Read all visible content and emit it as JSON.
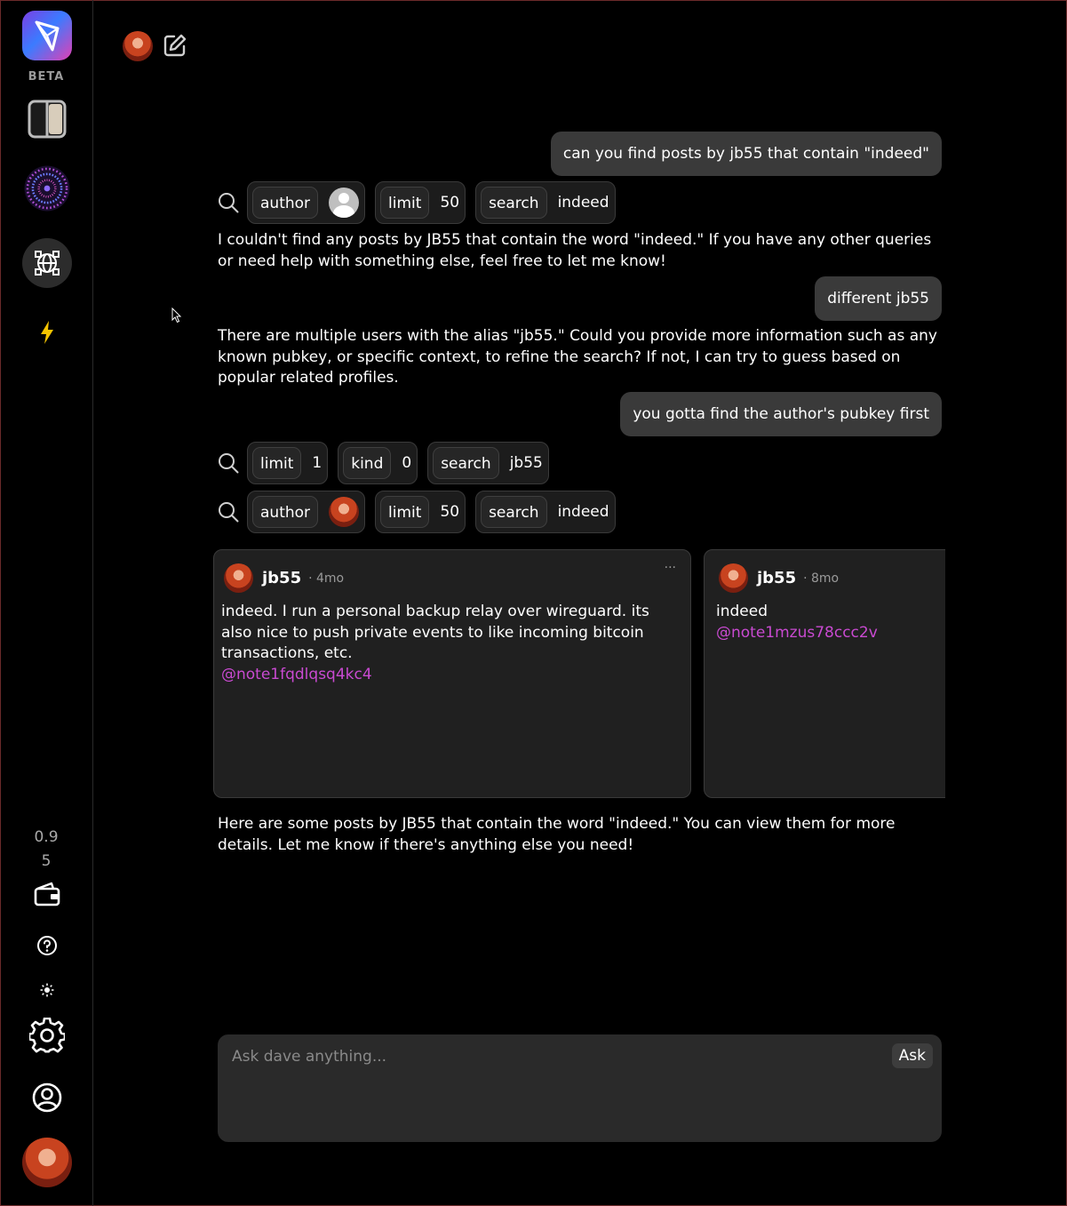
{
  "sidebar": {
    "beta_label": "BETA",
    "version_line1": "0.9",
    "version_line2": "5"
  },
  "chat": {
    "messages": [
      {
        "role": "user",
        "text": "can you find posts by jb55 that contain \"indeed\""
      },
      {
        "role": "assistant",
        "text": "I couldn't find any posts by JB55 that contain the word \"indeed.\" If you have any other queries or need help with something else, feel free to let me know!"
      },
      {
        "role": "user",
        "text": "different jb55"
      },
      {
        "role": "assistant",
        "text": "There are multiple users with the alias \"jb55.\" Could you provide more information such as any known pubkey, or specific context, to refine the search? If not, I can try to guess based on popular related profiles."
      },
      {
        "role": "user",
        "text": "you gotta find the author's pubkey first"
      },
      {
        "role": "assistant",
        "text": "Here are some posts by JB55 that contain the word \"indeed.\" You can view them for more details. Let me know if there's anything else you need!"
      }
    ],
    "tool_calls": [
      {
        "chips": [
          {
            "key": "author",
            "value": ""
          },
          {
            "key": "limit",
            "value": "50"
          },
          {
            "key": "search",
            "value": "indeed"
          }
        ]
      },
      {
        "chips": [
          {
            "key": "limit",
            "value": "1"
          },
          {
            "key": "kind",
            "value": "0"
          },
          {
            "key": "search",
            "value": "jb55"
          }
        ]
      },
      {
        "chips": [
          {
            "key": "author",
            "value": ""
          },
          {
            "key": "limit",
            "value": "50"
          },
          {
            "key": "search",
            "value": "indeed"
          }
        ]
      }
    ],
    "posts": [
      {
        "author": "jb55",
        "time": "· 4mo",
        "more": "···",
        "text": "indeed. I run a personal backup relay over wireguard. its also nice to push private events to like incoming bitcoin transactions, etc.",
        "mention": "@note1fqdlqsq4kc4"
      },
      {
        "author": "jb55",
        "time": "· 8mo",
        "text": "indeed",
        "mention": "@note1mzus78ccc2v"
      }
    ]
  },
  "input": {
    "placeholder": "Ask dave anything...",
    "ask_label": "Ask"
  },
  "colors": {
    "background": "#000000",
    "bubble": "#3a3a3a",
    "card": "#202020",
    "mention": "#c94ad1",
    "zap": "#f5c400"
  }
}
